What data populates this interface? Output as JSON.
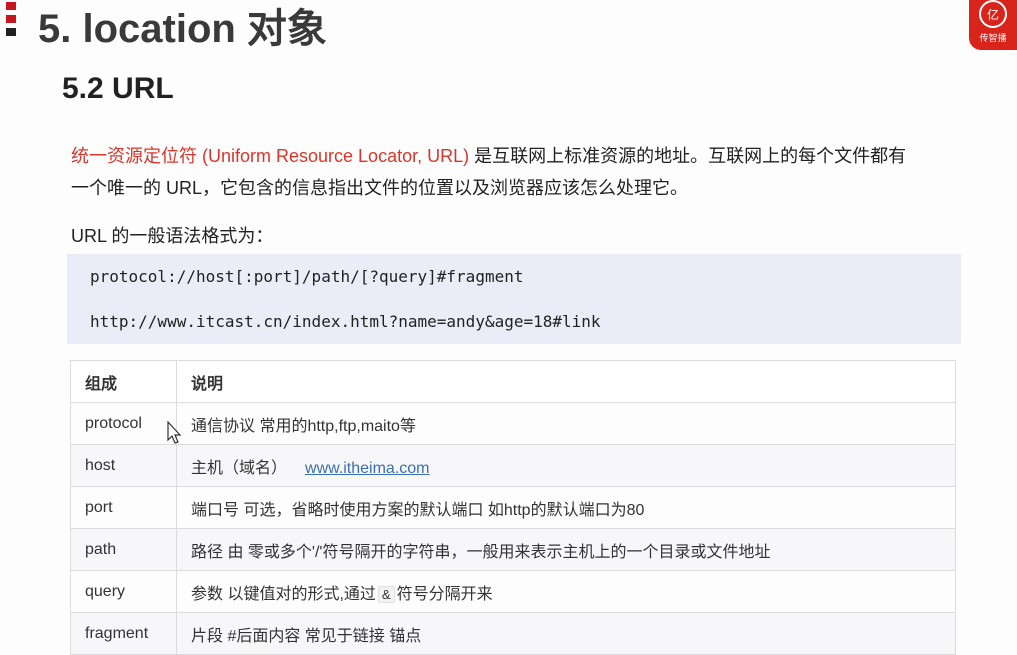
{
  "header": {
    "title": "5. location 对象",
    "logo_symbol": "亿",
    "logo_text": "传智播",
    "accent_color": "#c9151e"
  },
  "section": {
    "title": "5.2 URL"
  },
  "intro": {
    "highlight": "统一资源定位符 (Uniform Resource Locator, URL)",
    "text_part1": " 是互联网上标准资源的地址。互联网上的每个文件都有",
    "text_part2": "一个唯一的 URL，它包含的信息指出文件的位置以及浏览器应该怎么处理它。"
  },
  "syntax": {
    "label": "URL 的一般语法格式为：",
    "format": "protocol://host[:port]/path/[?query]#fragment",
    "example": "http://www.itcast.cn/index.html?name=andy&age=18#link"
  },
  "table": {
    "headers": [
      "组成",
      "说明"
    ],
    "rows": [
      {
        "name": "protocol",
        "desc": "通信协议 常用的http,ftp,maito等"
      },
      {
        "name": "host",
        "desc": "主机（域名）",
        "link": "www.itheima.com"
      },
      {
        "name": "port",
        "desc": "端口号 可选，省略时使用方案的默认端口 如http的默认端口为80"
      },
      {
        "name": "path",
        "desc": "路径 由 零或多个'/'符号隔开的字符串，一般用来表示主机上的一个目录或文件地址"
      },
      {
        "name": "query",
        "desc_before": "参数  以键值对的形式,通过",
        "amp": "&",
        "desc_after": "符号分隔开来"
      },
      {
        "name": "fragment",
        "desc": "片段  #后面内容 常见于链接 锚点"
      }
    ]
  }
}
